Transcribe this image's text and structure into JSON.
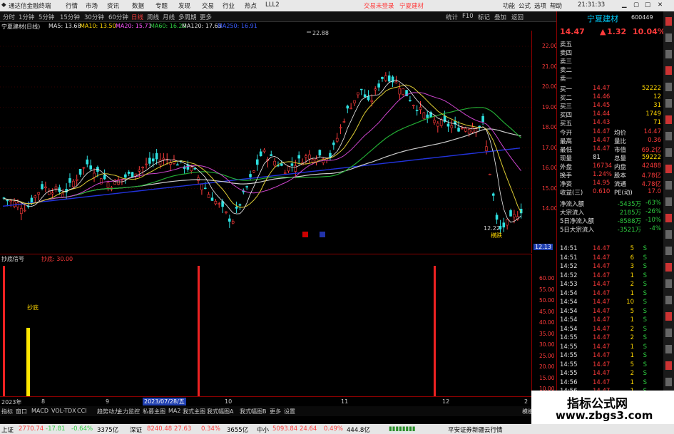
{
  "titlebar": {
    "app": "通达信金融终端",
    "menus": [
      "行情",
      "市场",
      "资讯",
      "数据",
      "专题",
      "发现",
      "交易",
      "行业",
      "热点",
      "LLL2"
    ],
    "notice": "交易未登录",
    "stock": "宁夏建材",
    "right": [
      "功能",
      "公式",
      "选项",
      "帮助"
    ],
    "clock": "21:31:33"
  },
  "periodbar": {
    "items": [
      "分时",
      "1分钟",
      "5分钟",
      "15分钟",
      "30分钟",
      "60分钟",
      "日线",
      "周线",
      "月线",
      "多周期",
      "更多"
    ],
    "active": "日线",
    "right": [
      "统计",
      "F10",
      "标记",
      "叠加",
      "返回"
    ]
  },
  "ma_legend": {
    "stock": "宁夏建材(日线)",
    "ma5": "MA5: 13.68",
    "ma10": "MA10: 13.50",
    "ma20": "MA20: 15.71",
    "ma60": "MA60: 16.20",
    "ma120": "MA120: 17.63",
    "ma250": "MA250: 16.91"
  },
  "price_axis": [
    "22.00",
    "21.00",
    "20.00",
    "19.00",
    "18.00",
    "17.00",
    "16.00",
    "15.00",
    "14.00"
  ],
  "price_now": "12.13",
  "chart_marks": {
    "high": "22.88",
    "low": "12.22",
    "lowlabel": "横跌"
  },
  "indicator": {
    "name": "抄底信号",
    "param": "抄底: 30.00",
    "axis": [
      "60.00",
      "55.00",
      "50.00",
      "45.00",
      "40.00",
      "35.00",
      "30.00",
      "25.00",
      "20.00",
      "15.00",
      "10.00",
      "5.00"
    ],
    "label": "抄底",
    "dates": [
      "2023年",
      "8",
      "9",
      "2023/07/28/五",
      "10",
      "11",
      "12",
      "2"
    ]
  },
  "tabs": [
    "指标",
    "窗口",
    "MACD",
    "VOL-TDX",
    "CCI",
    "趋势动力",
    "主力监控",
    "私募主图",
    "MA2",
    "我式主图",
    "我式幅图A",
    "我式幅图B",
    "更多",
    "设置",
    "模板"
  ],
  "side": {
    "header_name": "宁夏建材",
    "header_code": "600449",
    "price": "14.47",
    "change": "1.32",
    "pct": "10.04%",
    "sells": [
      {
        "label": "卖五",
        "price": "",
        "vol": ""
      },
      {
        "label": "卖四",
        "price": "",
        "vol": ""
      },
      {
        "label": "卖三",
        "price": "",
        "vol": ""
      },
      {
        "label": "卖二",
        "price": "",
        "vol": ""
      },
      {
        "label": "卖一",
        "price": "",
        "vol": ""
      }
    ],
    "buys": [
      {
        "label": "买一",
        "price": "14.47",
        "vol": "52222"
      },
      {
        "label": "买二",
        "price": "14.46",
        "vol": "12"
      },
      {
        "label": "买三",
        "price": "14.45",
        "vol": "31"
      },
      {
        "label": "买四",
        "price": "14.44",
        "vol": "1749"
      },
      {
        "label": "买五",
        "price": "14.43",
        "vol": "71"
      }
    ],
    "stats": [
      [
        "今开",
        "14.47",
        "均价",
        "14.47"
      ],
      [
        "最高",
        "14.47",
        "量比",
        "0.36"
      ],
      [
        "最低",
        "14.47",
        "市值",
        "69.2亿"
      ],
      [
        "现量",
        "81",
        "总量",
        "59222"
      ],
      [
        "外盘",
        "16734",
        "内盘",
        "42488"
      ],
      [
        "换手",
        "1.24%",
        "股本",
        "4.78亿"
      ],
      [
        "净资",
        "14.95",
        "流通",
        "4.78亿"
      ],
      [
        "收益(三)",
        "0.610",
        "PE(动)",
        "17.0"
      ]
    ],
    "flows": [
      {
        "label": "净流入额",
        "value": "-5435万",
        "pct": "-63%"
      },
      {
        "label": "大宗流入",
        "value": "2185万",
        "pct": "-26%"
      },
      {
        "label": "5日净流入额",
        "value": "-8588万",
        "pct": "-10%"
      },
      {
        "label": "5日大宗流入",
        "value": "-3521万",
        "pct": "-4%"
      }
    ],
    "ticks": [
      [
        "14:51",
        "14.47",
        "5",
        "S"
      ],
      [
        "14:51",
        "14.47",
        "6",
        "S"
      ],
      [
        "14:52",
        "14.47",
        "3",
        "S"
      ],
      [
        "14:52",
        "14.47",
        "1",
        "S"
      ],
      [
        "14:53",
        "14.47",
        "2",
        "S"
      ],
      [
        "14:54",
        "14.47",
        "1",
        "S"
      ],
      [
        "14:54",
        "14.47",
        "10",
        "S"
      ],
      [
        "14:54",
        "14.47",
        "5",
        "S"
      ],
      [
        "14:54",
        "14.47",
        "1",
        "S"
      ],
      [
        "14:54",
        "14.47",
        "2",
        "S"
      ],
      [
        "14:55",
        "14.47",
        "2",
        "S"
      ],
      [
        "14:55",
        "14.47",
        "1",
        "S"
      ],
      [
        "14:55",
        "14.47",
        "1",
        "S"
      ],
      [
        "14:55",
        "14.47",
        "5",
        "S"
      ],
      [
        "14:55",
        "14.47",
        "2",
        "S"
      ],
      [
        "14:56",
        "14.47",
        "1",
        "S"
      ],
      [
        "14:56",
        "14.47",
        "1",
        "S"
      ],
      [
        "14:56",
        "14.47",
        "696",
        "S"
      ],
      [
        "14:56",
        "14.47",
        "2",
        "S"
      ]
    ]
  },
  "statusbar": {
    "items": [
      "上证",
      "2770.74",
      "-17.81",
      "-0.64%",
      "3375亿",
      "深证",
      "8240.48",
      "27.63",
      "0.34%",
      "3655亿",
      "中小",
      "5093.84",
      "24.64",
      "0.49%",
      "444.8亿"
    ],
    "right": "平安证券新疆云行情"
  },
  "watermark": {
    "title": "指标公式网",
    "url": "www.zbgs3.com"
  }
}
